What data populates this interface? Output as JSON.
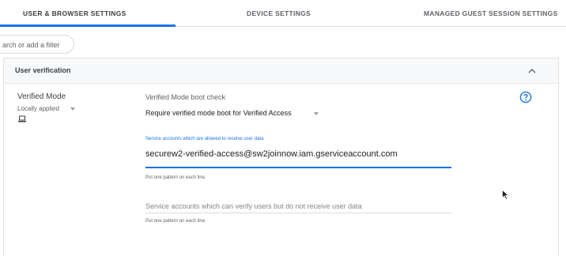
{
  "tabs": [
    {
      "label": "USER & BROWSER SETTINGS",
      "active": true
    },
    {
      "label": "DEVICE SETTINGS",
      "active": false
    },
    {
      "label": "MANAGED GUEST SESSION SETTINGS",
      "active": false
    }
  ],
  "filter": {
    "placeholder": "arch or add a filter"
  },
  "panel": {
    "title": "User verification"
  },
  "setting": {
    "name": "Verified Mode",
    "scope": "Locally applied",
    "boot_check_label": "Verified Mode boot check",
    "boot_check_value": "Require verified mode boot for Verified Access",
    "service_accounts_label": "Service accounts which are allowed to receive user data",
    "service_accounts_value": "securew2-verified-access@sw2joinnow.iam.gserviceaccount.com",
    "service_accounts_hint": "Put one pattern on each line.",
    "verify_only_label": "Service accounts which can verify users but do not receive user data",
    "verify_only_hint": "Put one pattern on each line."
  },
  "colors": {
    "accent": "#1a73e8",
    "muted": "#5f6368"
  },
  "icons": [
    "chevron-up-icon",
    "caret-down-icon",
    "laptop-icon",
    "help-icon",
    "mouse-cursor-icon"
  ]
}
